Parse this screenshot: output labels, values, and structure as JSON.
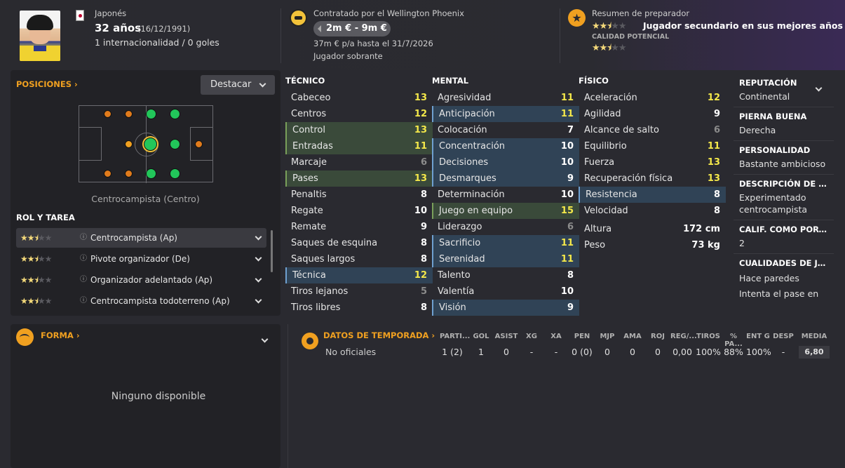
{
  "player": {
    "nationality": "Japonés",
    "age": "32 años",
    "dob": "(16/12/1991)",
    "caps": "1 internacionalidad / 0 goles"
  },
  "contract": {
    "title": "Contratado por el Wellington Phoenix",
    "value_range": "2m € - 9m €",
    "wage": "37m € p/a hasta el 31/7/2026",
    "status": "Jugador sobrante"
  },
  "coach": {
    "title": "Resumen de preparador",
    "summary": "Jugador secundario en sus mejores años",
    "potential_label": "CALIDAD POTENCIAL",
    "current_stars": 2.5,
    "potential_stars": 2.5
  },
  "positions": {
    "title": "POSICIONES",
    "dropdown": "Destacar",
    "position_name": "Centrocampista (Centro)"
  },
  "roles": {
    "title": "ROL Y TAREA",
    "items": [
      {
        "label": "Centrocampista (Ap)",
        "stars": 2.5
      },
      {
        "label": "Pivote organizador (De)",
        "stars": 2.5
      },
      {
        "label": "Organizador adelantado (Ap)",
        "stars": 2.5
      },
      {
        "label": "Centrocampista todoterreno (Ap)",
        "stars": 2.5
      }
    ]
  },
  "attributes": {
    "technical": {
      "title": "TÉCNICO",
      "rows": [
        {
          "name": "Cabeceo",
          "value": "13",
          "hl": "",
          "color": "y"
        },
        {
          "name": "Centros",
          "value": "12",
          "hl": "",
          "color": "y"
        },
        {
          "name": "Control",
          "value": "13",
          "hl": "g",
          "color": "y"
        },
        {
          "name": "Entradas",
          "value": "11",
          "hl": "g",
          "color": "y"
        },
        {
          "name": "Marcaje",
          "value": "6",
          "hl": "",
          "color": "gr"
        },
        {
          "name": "Pases",
          "value": "13",
          "hl": "g",
          "color": "y"
        },
        {
          "name": "Penaltis",
          "value": "8",
          "hl": "",
          "color": "w"
        },
        {
          "name": "Regate",
          "value": "10",
          "hl": "",
          "color": "w"
        },
        {
          "name": "Remate",
          "value": "9",
          "hl": "",
          "color": "w"
        },
        {
          "name": "Saques de esquina",
          "value": "8",
          "hl": "",
          "color": "w"
        },
        {
          "name": "Saques largos",
          "value": "8",
          "hl": "",
          "color": "w"
        },
        {
          "name": "Técnica",
          "value": "12",
          "hl": "b",
          "color": "y"
        },
        {
          "name": "Tiros lejanos",
          "value": "5",
          "hl": "",
          "color": "gr"
        },
        {
          "name": "Tiros libres",
          "value": "8",
          "hl": "",
          "color": "w"
        }
      ]
    },
    "mental": {
      "title": "MENTAL",
      "rows": [
        {
          "name": "Agresividad",
          "value": "11",
          "hl": "",
          "color": "y"
        },
        {
          "name": "Anticipación",
          "value": "11",
          "hl": "b",
          "color": "y"
        },
        {
          "name": "Colocación",
          "value": "7",
          "hl": "",
          "color": "w"
        },
        {
          "name": "Concentración",
          "value": "10",
          "hl": "b",
          "color": "w"
        },
        {
          "name": "Decisiones",
          "value": "10",
          "hl": "b",
          "color": "w"
        },
        {
          "name": "Desmarques",
          "value": "9",
          "hl": "b",
          "color": "w"
        },
        {
          "name": "Determinación",
          "value": "10",
          "hl": "",
          "color": "w"
        },
        {
          "name": "Juego en equipo",
          "value": "15",
          "hl": "g",
          "color": "y"
        },
        {
          "name": "Liderazgo",
          "value": "6",
          "hl": "",
          "color": "gr"
        },
        {
          "name": "Sacrificio",
          "value": "11",
          "hl": "b",
          "color": "y"
        },
        {
          "name": "Serenidad",
          "value": "11",
          "hl": "b",
          "color": "y"
        },
        {
          "name": "Talento",
          "value": "8",
          "hl": "",
          "color": "w"
        },
        {
          "name": "Valentía",
          "value": "10",
          "hl": "",
          "color": "w"
        },
        {
          "name": "Visión",
          "value": "9",
          "hl": "b",
          "color": "w"
        }
      ]
    },
    "physical": {
      "title": "FÍSICO",
      "rows": [
        {
          "name": "Aceleración",
          "value": "12",
          "hl": "",
          "color": "y"
        },
        {
          "name": "Agilidad",
          "value": "9",
          "hl": "",
          "color": "w"
        },
        {
          "name": "Alcance de salto",
          "value": "6",
          "hl": "",
          "color": "gr"
        },
        {
          "name": "Equilibrio",
          "value": "11",
          "hl": "",
          "color": "y"
        },
        {
          "name": "Fuerza",
          "value": "13",
          "hl": "",
          "color": "y"
        },
        {
          "name": "Recuperación física",
          "value": "13",
          "hl": "",
          "color": "y"
        },
        {
          "name": "Resistencia",
          "value": "8",
          "hl": "b",
          "color": "w"
        },
        {
          "name": "Velocidad",
          "value": "8",
          "hl": "",
          "color": "w"
        }
      ],
      "height_label": "Altura",
      "height": "172 cm",
      "weight_label": "Peso",
      "weight": "73 kg"
    }
  },
  "info": [
    {
      "key": "REPUTACIÓN",
      "value": "Continental"
    },
    {
      "key": "PIERNA BUENA",
      "value": "Derecha"
    },
    {
      "key": "PERSONALIDAD",
      "value": "Bastante ambicioso"
    },
    {
      "key": "DESCRIPCIÓN DE LA...",
      "value": "Experimentado centrocampista"
    },
    {
      "key": "CALIF. COMO PORT...",
      "value": "2"
    },
    {
      "key": "CUALIDADES DE JUGA",
      "value": "Hace paredes\nIntenta el pase en"
    }
  ],
  "form": {
    "title": "FORMA",
    "empty": "Ninguno disponible"
  },
  "season": {
    "title": "DATOS DE TEMPORADA",
    "headers": [
      "PARTI...",
      "GOL",
      "ASIST",
      "XG",
      "XA",
      "PEN",
      "MJP",
      "AMA",
      "ROJ",
      "REG/...",
      "TIROS",
      "% PA...",
      "ENT G",
      "DESP",
      "MEDIA"
    ],
    "row_label": "No oficiales",
    "row": [
      "1 (2)",
      "1",
      "0",
      "-",
      "-",
      "0 (0)",
      "0",
      "0",
      "0",
      "0,00",
      "100%",
      "88%",
      "100%",
      "-",
      "6,80"
    ]
  },
  "colors": {
    "accent": "#f0a020",
    "high_value": "#f4e84a",
    "highlight_green": "#3a4a3a",
    "highlight_blue": "#304356"
  }
}
